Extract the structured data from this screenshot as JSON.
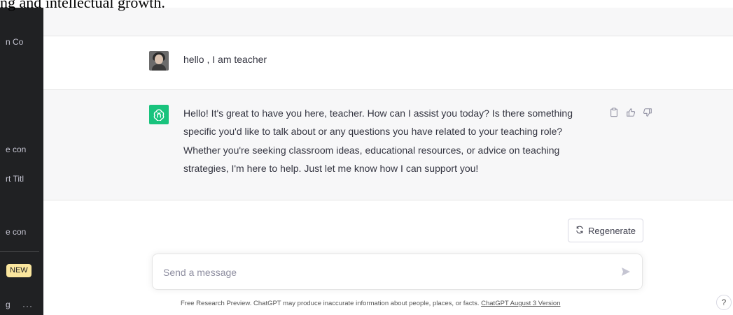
{
  "doc": {
    "top_text": "ng and intellectual growth."
  },
  "sidebar": {
    "items": [
      "n Co",
      "e con",
      "rt Titl",
      "e con",
      "g"
    ],
    "badge": "NEW",
    "more": "···"
  },
  "conversation": {
    "user_message": "hello , I am teacher",
    "assistant_message": "Hello! It's great to have you here, teacher. How can I assist you today? Is there something specific you'd like to talk about or any questions you have related to your teaching role? Whether you're seeking classroom ideas, educational resources, or advice on teaching strategies, I'm here to help. Just let me know how I can support you!"
  },
  "actions": {
    "copy_icon": "clipboard-icon",
    "like_icon": "thumbs-up-icon",
    "dislike_icon": "thumbs-down-icon"
  },
  "regenerate": {
    "label": "Regenerate"
  },
  "composer": {
    "placeholder": "Send a message"
  },
  "footer": {
    "text": "Free Research Preview. ChatGPT may produce inaccurate information about people, places, or facts.",
    "link": "ChatGPT August 3 Version"
  },
  "help": {
    "label": "?"
  },
  "colors": {
    "accent": "#19c37d",
    "sidebar_bg": "#202123",
    "badge_bg": "#fae69e"
  }
}
